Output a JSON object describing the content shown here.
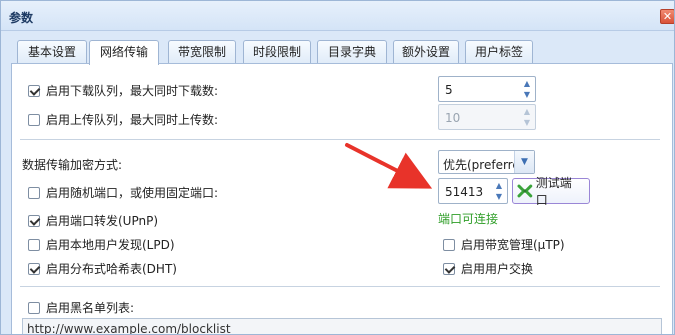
{
  "window": {
    "title": "参数",
    "close_symbol": "✕"
  },
  "tabs": [
    {
      "label": "基本设置",
      "active": false
    },
    {
      "label": "网络传输",
      "active": true
    },
    {
      "label": "带宽限制",
      "active": false
    },
    {
      "label": "时段限制",
      "active": false
    },
    {
      "label": "目录字典",
      "active": false
    },
    {
      "label": "额外设置",
      "active": false
    },
    {
      "label": "用户标签",
      "active": false
    }
  ],
  "queue": {
    "download_label": "启用下载队列，最大同时下载数:",
    "download_checked": true,
    "download_value": "5",
    "upload_label": "启用上传队列，最大同时上传数:",
    "upload_checked": false,
    "upload_value": "10"
  },
  "encryption": {
    "label": "数据传输加密方式:",
    "selected": "优先(preferre"
  },
  "port": {
    "random_label": "启用随机端口，或使用固定端口:",
    "random_checked": false,
    "value": "51413",
    "test_button": "测试端口",
    "status": "端口可连接"
  },
  "options": {
    "upnp_label": "启用端口转发(UPnP)",
    "upnp_checked": true,
    "lpd_label": "启用本地用户发现(LPD)",
    "lpd_checked": false,
    "utp_label": "启用带宽管理(µTP)",
    "utp_checked": false,
    "dht_label": "启用分布式哈希表(DHT)",
    "dht_checked": true,
    "pex_label": "启用用户交换",
    "pex_checked": true
  },
  "blocklist": {
    "label": "启用黑名单列表:",
    "checked": false,
    "url": "http://www.example.com/blocklist"
  },
  "colors": {
    "status_ok": "#2f9e28",
    "annotation_arrow": "#e8332a",
    "accent": "#4a78b8"
  }
}
